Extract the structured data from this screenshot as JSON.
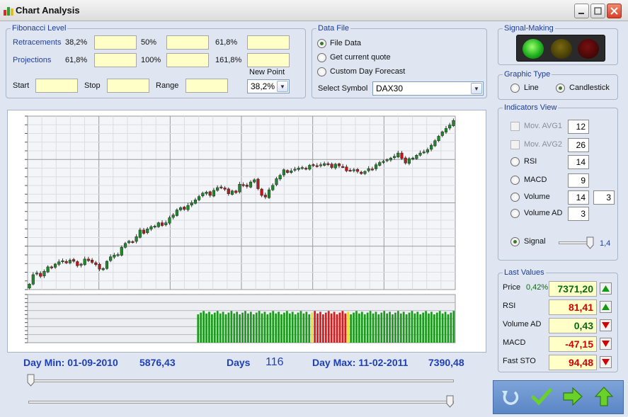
{
  "window": {
    "title": "Chart Analysis"
  },
  "fibonacci": {
    "legend": "Fibonacci Level",
    "retracements_label": "Retracements",
    "projections_label": "Projections",
    "retracement_levels": [
      "38,2%",
      "50%",
      "61,8%"
    ],
    "projection_levels": [
      "61,8%",
      "100%",
      "161,8%"
    ],
    "start_label": "Start",
    "stop_label": "Stop",
    "range_label": "Range",
    "new_point_label": "New Point",
    "new_point_value": "38,2%"
  },
  "data_file": {
    "legend": "Data File",
    "options": [
      "File Data",
      "Get current quote",
      "Custom Day Forecast"
    ],
    "selected_option": "File Data",
    "select_symbol_label": "Select Symbol",
    "symbol_value": "DAX30"
  },
  "signal_making": {
    "legend": "Signal-Making",
    "lights": [
      "green",
      "yellow",
      "red"
    ],
    "active_light": "green"
  },
  "graphic_type": {
    "legend": "Graphic Type",
    "options": [
      "Line",
      "Candlestick"
    ],
    "selected": "Candlestick"
  },
  "indicators": {
    "legend": "Indicators View",
    "items": [
      {
        "label": "Mov. AVG1",
        "kind": "checkbox",
        "enabled": false,
        "value": "12"
      },
      {
        "label": "Mov. AVG2",
        "kind": "checkbox",
        "enabled": false,
        "value": "26"
      },
      {
        "label": "RSI",
        "kind": "radio",
        "value": "14"
      },
      {
        "label": "MACD",
        "kind": "radio",
        "value": "9"
      },
      {
        "label": "Volume",
        "kind": "radio",
        "value": "14",
        "value2": "3"
      },
      {
        "label": "Volume AD",
        "kind": "radio",
        "value": "3"
      }
    ],
    "signal_label": "Signal",
    "signal_value": "1,4",
    "signal_level": 0.95
  },
  "last_values": {
    "legend": "Last Values",
    "rows": [
      {
        "label": "Price",
        "change": "0,42%",
        "value": "7371,20",
        "color": "#0b6a10",
        "direction": "up"
      },
      {
        "label": "RSI",
        "value": "81,41",
        "color": "#d40000",
        "direction": "up"
      },
      {
        "label": "Volume AD",
        "value": "0,43",
        "color": "#0b6a10",
        "direction": "down"
      },
      {
        "label": "MACD",
        "value": "-47,15",
        "color": "#d40000",
        "direction": "down"
      },
      {
        "label": "Fast STO",
        "value": "94,48",
        "color": "#d40000",
        "direction": "down"
      }
    ]
  },
  "stats": {
    "day_min_label": "Day Min: 01-09-2010",
    "day_min_value": "5876,43",
    "days_label": "Days",
    "days_value": "116",
    "day_max_label": "Day Max: 11-02-2011",
    "day_max_value": "7390,48"
  },
  "toolbar": {
    "icons": [
      "undo-icon",
      "checkmark-icon",
      "forward-arrow-icon",
      "up-arrow-icon"
    ]
  },
  "colors": {
    "accent_blue": "#1d3fb8",
    "candle_up": "#1f8a2a",
    "candle_down": "#c01818",
    "signal_bar_green": "#1a9a1a",
    "signal_bar_red": "#e01818",
    "signal_bar_yellow": "#f0e020"
  },
  "chart_data": {
    "type": "candlestick",
    "symbol": "DAX30",
    "days": 116,
    "range": {
      "min": 5876.43,
      "max": 7390.48
    },
    "close_series": [
      5905,
      5990,
      6005,
      5975,
      6020,
      6060,
      6050,
      6085,
      6105,
      6115,
      6095,
      6120,
      6110,
      6070,
      6085,
      6130,
      6115,
      6100,
      6080,
      6040,
      6045,
      6110,
      6150,
      6165,
      6170,
      6235,
      6270,
      6290,
      6285,
      6330,
      6390,
      6360,
      6400,
      6420,
      6425,
      6455,
      6430,
      6455,
      6500,
      6525,
      6570,
      6590,
      6575,
      6610,
      6635,
      6660,
      6690,
      6720,
      6730,
      6700,
      6745,
      6770,
      6770,
      6755,
      6715,
      6740,
      6725,
      6800,
      6790,
      6780,
      6820,
      6840,
      6760,
      6700,
      6685,
      6750,
      6790,
      6850,
      6880,
      6930,
      6905,
      6920,
      6935,
      6945,
      6950,
      6935,
      6970,
      6970,
      6965,
      6975,
      6985,
      6975,
      6950,
      6980,
      6965,
      6955,
      6920,
      6925,
      6930,
      6915,
      6895,
      6915,
      6940,
      6935,
      6975,
      6995,
      7005,
      7020,
      7035,
      7050,
      7080,
      7030,
      6990,
      7030,
      7035,
      7060,
      7080,
      7090,
      7110,
      7150,
      7190,
      7230,
      7270,
      7300,
      7330,
      7371
    ],
    "signal_bars": [
      "g",
      "g",
      "g",
      "g",
      "g",
      "g",
      "g",
      "g",
      "g",
      "g",
      "g",
      "g",
      "g",
      "g",
      "g",
      "g",
      "g",
      "g",
      "g",
      "g",
      "g",
      "g",
      "g",
      "g",
      "g",
      "g",
      "g",
      "g",
      "g",
      "g",
      "g",
      "g",
      "g",
      "g",
      "g",
      "g",
      "g",
      "g",
      "g",
      "g",
      "g",
      "y",
      "r",
      "r",
      "r",
      "r",
      "r",
      "r",
      "r",
      "r",
      "r",
      "r",
      "r",
      "r",
      "y",
      "g",
      "g",
      "g",
      "g",
      "g",
      "g",
      "g",
      "g",
      "g",
      "g",
      "g",
      "g",
      "g",
      "g",
      "g",
      "g",
      "g",
      "g",
      "g",
      "g",
      "g",
      "g",
      "g",
      "g",
      "g",
      "g",
      "g",
      "g",
      "g",
      "g",
      "g",
      "g",
      "g",
      "g",
      "g",
      "g",
      "g",
      "g"
    ]
  }
}
